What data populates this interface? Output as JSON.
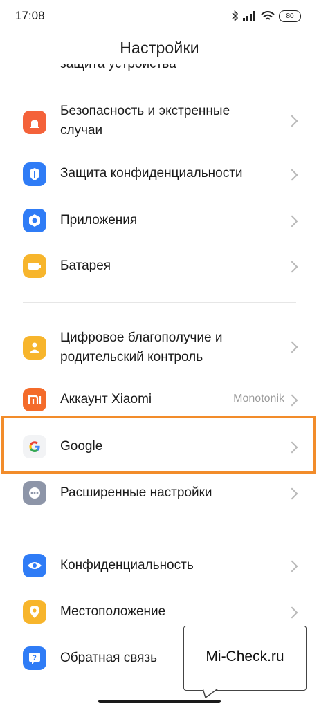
{
  "status_bar": {
    "time": "17:08",
    "battery": "80",
    "icons": [
      "bluetooth-icon",
      "signal-icon",
      "wifi-icon",
      "battery-icon"
    ]
  },
  "header": {
    "title": "Настройки"
  },
  "partial_item": {
    "label": "защита устройства"
  },
  "sections": [
    {
      "items": [
        {
          "label_lines": [
            "Безопасность и экстренные",
            "случаи"
          ],
          "icon": "emergency-icon",
          "color": "#f4623a"
        },
        {
          "label_lines": [
            "Защита конфиденциальности"
          ],
          "icon": "privacy-shield-icon",
          "color": "#2f7cf6"
        },
        {
          "label_lines": [
            "Приложения"
          ],
          "icon": "apps-gear-icon",
          "color": "#2f7cf6"
        },
        {
          "label_lines": [
            "Батарея"
          ],
          "icon": "battery-icon",
          "color": "#f7b52c"
        }
      ]
    },
    {
      "items": [
        {
          "label_lines": [
            "Цифровое благополучие и",
            "родительский контроль"
          ],
          "icon": "wellbeing-icon",
          "color": "#f7b52c"
        },
        {
          "label_lines": [
            "Аккаунт Xiaomi"
          ],
          "value": "Monotonik",
          "icon": "xiaomi-mi-icon",
          "color": "#f46b2a"
        },
        {
          "label_lines": [
            "Google"
          ],
          "icon": "google-icon",
          "color": "#f2f3f5",
          "highlighted": true
        },
        {
          "label_lines": [
            "Расширенные настройки"
          ],
          "icon": "more-dots-icon",
          "color": "#8d95a8"
        }
      ]
    },
    {
      "items": [
        {
          "label_lines": [
            "Конфиденциальность"
          ],
          "icon": "eye-icon",
          "color": "#2f7cf6"
        },
        {
          "label_lines": [
            "Местоположение"
          ],
          "icon": "location-pin-icon",
          "color": "#f7b52c"
        },
        {
          "label_lines": [
            "Обратная связь"
          ],
          "icon": "feedback-icon",
          "color": "#2f7cf6"
        }
      ]
    }
  ],
  "watermark": {
    "text": "Mi-Check.ru"
  },
  "colors": {
    "highlight_border": "#f28c2a",
    "chevron": "#b8b8b8",
    "value_text": "#9a9a9a"
  }
}
